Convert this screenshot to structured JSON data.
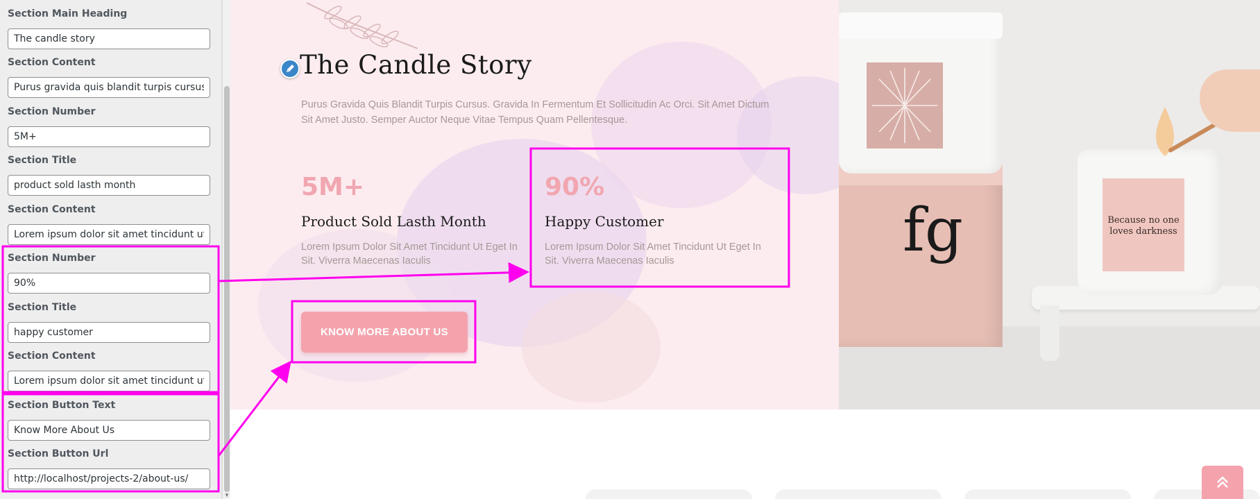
{
  "customizer": {
    "fields": [
      {
        "label": "Section Main Heading",
        "value": "The candle story"
      },
      {
        "label": "Section Content",
        "value": "Purus gravida quis blandit turpis cursus. Gravida in fermentum et sollicitudin ac orci."
      },
      {
        "label": "Section Number",
        "value": "5M+"
      },
      {
        "label": "Section Title",
        "value": "product sold lasth month"
      },
      {
        "label": "Section Content",
        "value": "Lorem ipsum dolor sit amet tincidunt ut eget in sit."
      },
      {
        "label": "Section Number",
        "value": "90%"
      },
      {
        "label": "Section Title",
        "value": "happy customer"
      },
      {
        "label": "Section Content",
        "value": "Lorem ipsum dolor sit amet tincidunt ut eget in sit."
      },
      {
        "label": "Section Button Text",
        "value": "Know More About Us"
      },
      {
        "label": "Section Button Url",
        "value": "http://localhost/projects-2/about-us/"
      }
    ]
  },
  "preview": {
    "heading": "The Candle Story",
    "description": "Purus Gravida Quis Blandit Turpis Cursus. Gravida In Fermentum Et Sollicitudin Ac Orci. Sit Amet Dictum Sit Amet Justo. Semper Auctor Neque Vitae Tempus Quam Pellentesque.",
    "stats": [
      {
        "number": "5M+",
        "title": "Product Sold Lasth Month",
        "text": "Lorem Ipsum Dolor Sit Amet Tincidunt Ut Eget In Sit. Viverra Maecenas Iaculis"
      },
      {
        "number": "90%",
        "title": "Happy Customer",
        "text": "Lorem Ipsum Dolor Sit Amet Tincidunt Ut Eget In Sit. Viverra Maecenas Iaculis"
      }
    ],
    "button_label": "KNOW MORE ABOUT US",
    "product_image": {
      "box_logo": "fg",
      "jar_label": "Because no one loves darkness"
    }
  },
  "icons": {
    "edit": "pencil-edit-icon",
    "scroll_top": "chevron-double-up-icon"
  },
  "colors": {
    "accent": "#f4a3ad",
    "stat_number": "#f1a6b0",
    "hero_background": "#fcecef",
    "annotation": "#ff00ee",
    "edit_icon": "#3a86c8"
  }
}
